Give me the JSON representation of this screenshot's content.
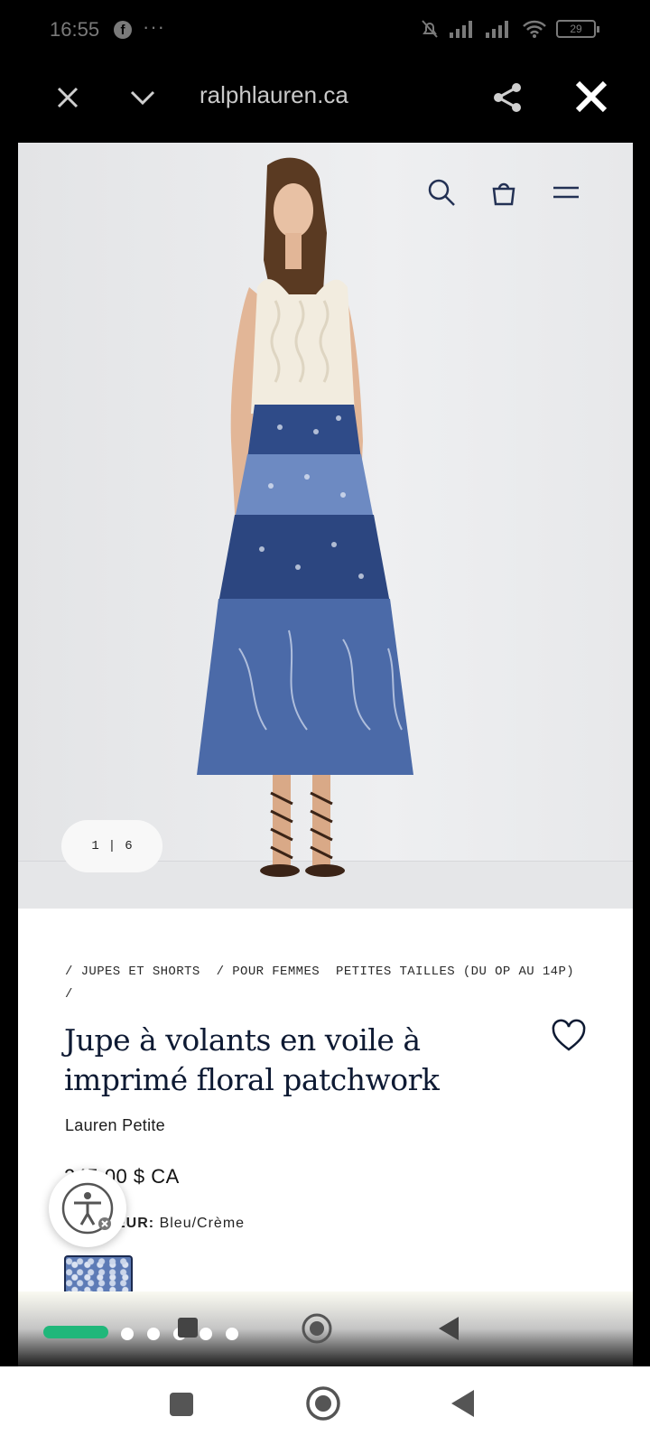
{
  "status_bar": {
    "time": "16:55",
    "fb_glyph": "f",
    "more": "···",
    "battery": "29",
    "icons": [
      "mute-icon",
      "signal-icon",
      "signal-icon",
      "wifi-icon",
      "battery-icon"
    ]
  },
  "browser": {
    "url": "ralphlauren.ca",
    "icons": [
      "close-icon",
      "chevron-down-icon",
      "share-icon",
      "close-icon"
    ]
  },
  "site_header": {
    "icons": [
      "search-icon",
      "shopping-bag-icon",
      "menu-icon"
    ]
  },
  "gallery": {
    "current": "1",
    "separator": "|",
    "total": "6"
  },
  "breadcrumbs": [
    "/ JUPES ET SHORTS",
    "/ POUR FEMMES",
    "PETITES TAILLES (DU OP AU 14P) /"
  ],
  "product": {
    "title_line1": "Jupe à volants en voile à",
    "title_line2": "imprimé floral patchwork",
    "brand": "Lauren Petite",
    "price": "245,00 $ CA",
    "color_label": "EUR:",
    "color_value": "Bleu/Crème"
  },
  "colors": {
    "title": "#0e1a33",
    "accent_progress": "#20b77a",
    "skirt_blue": "#3d5a9b"
  }
}
